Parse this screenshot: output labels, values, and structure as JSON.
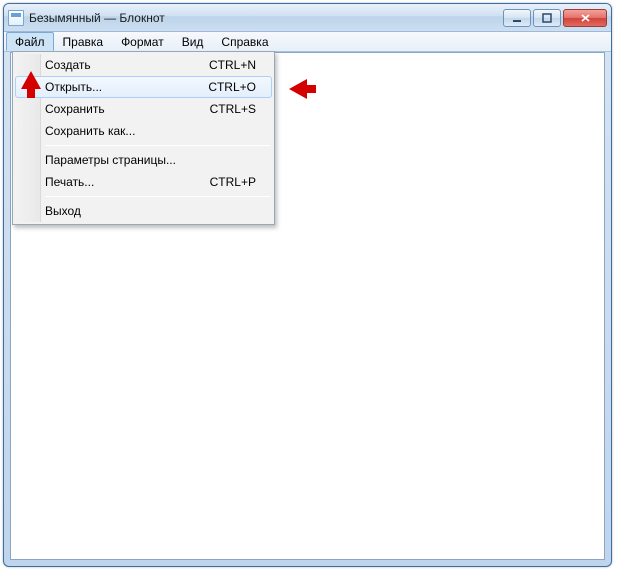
{
  "window": {
    "title": "Безымянный — Блокнот"
  },
  "menubar": {
    "items": [
      {
        "label": "Файл",
        "open": true
      },
      {
        "label": "Правка",
        "open": false
      },
      {
        "label": "Формат",
        "open": false
      },
      {
        "label": "Вид",
        "open": false
      },
      {
        "label": "Справка",
        "open": false
      }
    ]
  },
  "file_menu": {
    "items": [
      {
        "label": "Создать",
        "shortcut": "CTRL+N",
        "highlight": false
      },
      {
        "label": "Открыть...",
        "shortcut": "CTRL+O",
        "highlight": true
      },
      {
        "label": "Сохранить",
        "shortcut": "CTRL+S",
        "highlight": false
      },
      {
        "label": "Сохранить как...",
        "shortcut": "",
        "highlight": false
      },
      {
        "sep": true
      },
      {
        "label": "Параметры страницы...",
        "shortcut": "",
        "highlight": false
      },
      {
        "label": "Печать...",
        "shortcut": "CTRL+P",
        "highlight": false
      },
      {
        "sep": true
      },
      {
        "label": "Выход",
        "shortcut": "",
        "highlight": false
      }
    ]
  }
}
